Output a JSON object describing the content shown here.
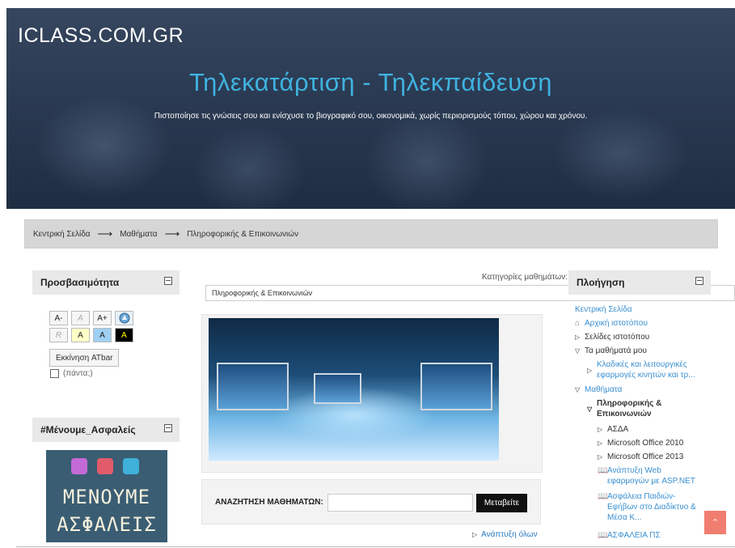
{
  "header": {
    "site_name": "ICLASS.COM.GR",
    "title": "Τηλεκατάρτιση - Τηλεκπαίδευση",
    "subtitle": "Πιστοποίησε τις γνώσεις σου και ενίσχυσε το βιογραφικό σου, οικονομικά, χωρίς περιορισμούς τόπου, χώρου και χρόνου."
  },
  "breadcrumb": [
    "Κεντρική Σελίδα",
    "Μαθήματα",
    "Πληροφορικής & Επικοινωνιών"
  ],
  "accessibility": {
    "title": "Προσβασιμότητα",
    "row1": [
      "A-",
      "A",
      "A+"
    ],
    "row2": [
      "R",
      "A",
      "A",
      "A"
    ],
    "start_button": "Εκκίνηση ATbar",
    "always_label": "(πάντα;)"
  },
  "safety_block": {
    "title": "#Μένουμε_Ασφαλείς",
    "image_line1": "ΜΕΝΟΥΜΕ",
    "image_line2": "ΑΣΦΑΛΕΙΣ"
  },
  "main": {
    "categories_label": "Κατηγορίες μαθημάτων:",
    "selected_category": "Πληροφορικής & Επικοινωνιών",
    "search_label": "ΑΝΑΖΗΤΗΣΗ ΜΑΘΗΜΑΤΩΝ:",
    "search_button": "Μεταβείτε",
    "expand_all": "Ανάπτυξη όλων"
  },
  "navigation": {
    "title": "Πλοήγηση",
    "home": "Κεντρική Σελίδα",
    "site_home": "Αρχική ιστοτόπου",
    "site_pages": "Σελίδες ιστοτόπου",
    "my_courses": "Τα μαθήματά μου",
    "my_course_1": "Κλαδικές και λειτουργικές εφαρμογές κινητών και τρ...",
    "courses": "Μαθήματα",
    "category": "Πληροφορικής & Επικοινωνιών",
    "sub_1": "ΑΣΔΑ",
    "sub_2": "Microsoft Office 2010",
    "sub_3": "Microsoft Office 2013",
    "course_1": "Ανάπτυξη Web εφαρμογών με ASP.NET",
    "course_2": "Ασφάλεια Παιδιών-Εφήβων στο Διαδίκτυο & Μέσα Κ...",
    "course_3": "ΑΣΦΑΛΕΙΑ ΠΣ"
  }
}
